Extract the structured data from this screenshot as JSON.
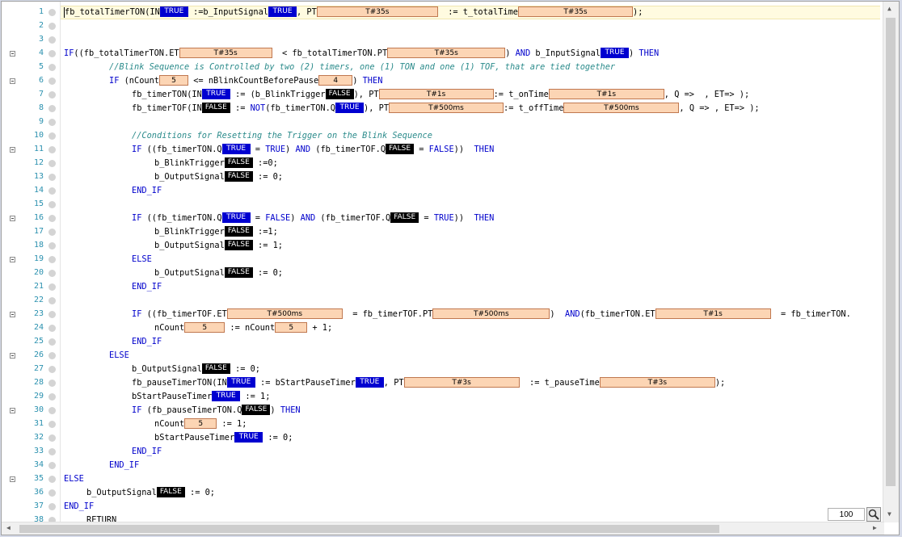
{
  "zoom": "100",
  "colors": {
    "true_bg": "#0000d0",
    "false_bg": "#000000",
    "value_bg": "#fcd5b4",
    "keyword": "#0000cc",
    "comment": "#2b8b8b",
    "line_number": "#2b91af"
  },
  "icons": {
    "fold": "collapse-minus-icon",
    "breakpoint": "breakpoint-dot-icon",
    "zoom": "magnifier-zoom-icon"
  },
  "lines": [
    {
      "n": "1",
      "fold": false,
      "ind": 0,
      "tok": [
        [
          "t",
          "fb_totalTimerTON(IN"
        ],
        [
          "mon",
          "true",
          "TRUE"
        ],
        [
          "t",
          " :=b_InputSignal"
        ],
        [
          "mon",
          "true",
          "TRUE"
        ],
        [
          "t",
          ", PT"
        ],
        [
          "val",
          "T#35s",
          150
        ],
        [
          "t",
          "  := t_totalTime"
        ],
        [
          "val",
          "T#35s",
          142
        ],
        [
          "t",
          ");"
        ]
      ]
    },
    {
      "n": "2",
      "fold": false,
      "ind": 0,
      "tok": []
    },
    {
      "n": "3",
      "fold": false,
      "ind": 0,
      "tok": []
    },
    {
      "n": "4",
      "fold": true,
      "ind": 0,
      "tok": [
        [
          "kw",
          "IF"
        ],
        [
          "t",
          "((fb_totalTimerTON.ET"
        ],
        [
          "val",
          "T#35s",
          115
        ],
        [
          "t",
          "  < fb_totalTimerTON.PT"
        ],
        [
          "val",
          "T#35s",
          146
        ],
        [
          "t",
          ") "
        ],
        [
          "kw",
          "AND"
        ],
        [
          "t",
          " b_InputSignal"
        ],
        [
          "mon",
          "true",
          "TRUE"
        ],
        [
          "t",
          ") "
        ],
        [
          "kw",
          "THEN"
        ]
      ]
    },
    {
      "n": "5",
      "fold": false,
      "ind": 8,
      "tok": [
        [
          "cm",
          "//Blink Sequence is Controlled by two (2) timers, one (1) TON and one (1) TOF, that are tied together"
        ]
      ]
    },
    {
      "n": "6",
      "fold": true,
      "ind": 8,
      "tok": [
        [
          "kw",
          "IF"
        ],
        [
          "t",
          " (nCount"
        ],
        [
          "val",
          "5",
          36
        ],
        [
          "t",
          " <= nBlinkCountBeforePause"
        ],
        [
          "val",
          "4",
          42
        ],
        [
          "t",
          ") "
        ],
        [
          "kw",
          "THEN"
        ]
      ]
    },
    {
      "n": "7",
      "fold": false,
      "ind": 12,
      "tok": [
        [
          "t",
          "fb_timerTON(IN"
        ],
        [
          "mon",
          "true",
          "TRUE"
        ],
        [
          "t",
          " := (b_BlinkTrigger"
        ],
        [
          "mon",
          "false",
          "FALSE"
        ],
        [
          "t",
          "), PT"
        ],
        [
          "val",
          "T#1s",
          142
        ],
        [
          "t",
          ":= t_onTime"
        ],
        [
          "val",
          "T#1s",
          143
        ],
        [
          "t",
          ", Q =>  , ET=> );"
        ]
      ]
    },
    {
      "n": "8",
      "fold": false,
      "ind": 12,
      "tok": [
        [
          "t",
          "fb_timerTOF(IN"
        ],
        [
          "mon",
          "false",
          "FALSE"
        ],
        [
          "t",
          " := "
        ],
        [
          "kw",
          "NOT"
        ],
        [
          "t",
          "(fb_timerTON.Q"
        ],
        [
          "mon",
          "true",
          "TRUE"
        ],
        [
          "t",
          "), PT"
        ],
        [
          "val",
          "T#500ms",
          142
        ],
        [
          "t",
          ":= t_offTime"
        ],
        [
          "val",
          "T#500ms",
          143
        ],
        [
          "t",
          ", Q => , ET=> );"
        ]
      ]
    },
    {
      "n": "9",
      "fold": false,
      "ind": 0,
      "tok": []
    },
    {
      "n": "10",
      "fold": false,
      "ind": 12,
      "tok": [
        [
          "cm",
          "//Conditions for Resetting the Trigger on the Blink Sequence"
        ]
      ]
    },
    {
      "n": "11",
      "fold": true,
      "ind": 12,
      "tok": [
        [
          "kw",
          "IF"
        ],
        [
          "t",
          " ((fb_timerTON.Q"
        ],
        [
          "mon",
          "true",
          "TRUE"
        ],
        [
          "t",
          " = "
        ],
        [
          "lit",
          "TRUE"
        ],
        [
          "t",
          ") "
        ],
        [
          "kw",
          "AND"
        ],
        [
          "t",
          " (fb_timerTOF.Q"
        ],
        [
          "mon",
          "false",
          "FALSE"
        ],
        [
          "t",
          " = "
        ],
        [
          "lit",
          "FALSE"
        ],
        [
          "t",
          "))  "
        ],
        [
          "kw",
          "THEN"
        ]
      ]
    },
    {
      "n": "12",
      "fold": false,
      "ind": 16,
      "tok": [
        [
          "t",
          "b_BlinkTrigger"
        ],
        [
          "mon",
          "false",
          "FALSE"
        ],
        [
          "t",
          " :=0;"
        ]
      ]
    },
    {
      "n": "13",
      "fold": false,
      "ind": 16,
      "tok": [
        [
          "t",
          "b_OutputSignal"
        ],
        [
          "mon",
          "false",
          "FALSE"
        ],
        [
          "t",
          " := 0;"
        ]
      ]
    },
    {
      "n": "14",
      "fold": false,
      "ind": 12,
      "tok": [
        [
          "kw",
          "END_IF"
        ]
      ]
    },
    {
      "n": "15",
      "fold": false,
      "ind": 0,
      "tok": []
    },
    {
      "n": "16",
      "fold": true,
      "ind": 12,
      "tok": [
        [
          "kw",
          "IF"
        ],
        [
          "t",
          " ((fb_timerTON.Q"
        ],
        [
          "mon",
          "true",
          "TRUE"
        ],
        [
          "t",
          " = "
        ],
        [
          "lit",
          "FALSE"
        ],
        [
          "t",
          ") "
        ],
        [
          "kw",
          "AND"
        ],
        [
          "t",
          " (fb_timerTOF.Q"
        ],
        [
          "mon",
          "false",
          "FALSE"
        ],
        [
          "t",
          " = "
        ],
        [
          "lit",
          "TRUE"
        ],
        [
          "t",
          "))  "
        ],
        [
          "kw",
          "THEN"
        ]
      ]
    },
    {
      "n": "17",
      "fold": false,
      "ind": 16,
      "tok": [
        [
          "t",
          "b_BlinkTrigger"
        ],
        [
          "mon",
          "false",
          "FALSE"
        ],
        [
          "t",
          " :=1;"
        ]
      ]
    },
    {
      "n": "18",
      "fold": false,
      "ind": 16,
      "tok": [
        [
          "t",
          "b_OutputSignal"
        ],
        [
          "mon",
          "false",
          "FALSE"
        ],
        [
          "t",
          " := 1;"
        ]
      ]
    },
    {
      "n": "19",
      "fold": true,
      "ind": 12,
      "tok": [
        [
          "kw",
          "ELSE"
        ]
      ]
    },
    {
      "n": "20",
      "fold": false,
      "ind": 16,
      "tok": [
        [
          "t",
          "b_OutputSignal"
        ],
        [
          "mon",
          "false",
          "FALSE"
        ],
        [
          "t",
          " := 0;"
        ]
      ]
    },
    {
      "n": "21",
      "fold": false,
      "ind": 12,
      "tok": [
        [
          "kw",
          "END_IF"
        ]
      ]
    },
    {
      "n": "22",
      "fold": false,
      "ind": 0,
      "tok": []
    },
    {
      "n": "23",
      "fold": true,
      "ind": 12,
      "tok": [
        [
          "kw",
          "IF"
        ],
        [
          "t",
          " ((fb_timerTOF.ET"
        ],
        [
          "val",
          "T#500ms",
          143
        ],
        [
          "t",
          "  = fb_timerTOF.PT"
        ],
        [
          "val",
          "T#500ms",
          145
        ],
        [
          "t",
          ")  "
        ],
        [
          "kw",
          "AND"
        ],
        [
          "t",
          "(fb_timerTON.ET"
        ],
        [
          "val",
          "T#1s",
          143
        ],
        [
          "t",
          "  = fb_timerTON."
        ]
      ]
    },
    {
      "n": "24",
      "fold": false,
      "ind": 16,
      "tok": [
        [
          "t",
          "nCount"
        ],
        [
          "val",
          "5",
          50
        ],
        [
          "t",
          " := nCount"
        ],
        [
          "val",
          "5",
          40
        ],
        [
          "t",
          " + 1;"
        ]
      ]
    },
    {
      "n": "25",
      "fold": false,
      "ind": 12,
      "tok": [
        [
          "kw",
          "END_IF"
        ]
      ]
    },
    {
      "n": "26",
      "fold": true,
      "ind": 8,
      "tok": [
        [
          "kw",
          "ELSE"
        ]
      ]
    },
    {
      "n": "27",
      "fold": false,
      "ind": 12,
      "tok": [
        [
          "t",
          "b_OutputSignal"
        ],
        [
          "mon",
          "false",
          "FALSE"
        ],
        [
          "t",
          " := 0;"
        ]
      ]
    },
    {
      "n": "28",
      "fold": false,
      "ind": 12,
      "tok": [
        [
          "t",
          "fb_pauseTimerTON(IN"
        ],
        [
          "mon",
          "true",
          "TRUE"
        ],
        [
          "t",
          " := bStartPauseTimer"
        ],
        [
          "mon",
          "true",
          "TRUE"
        ],
        [
          "t",
          ", PT"
        ],
        [
          "val",
          "T#3s",
          143
        ],
        [
          "t",
          "  := t_pauseTime"
        ],
        [
          "val",
          "T#3s",
          143
        ],
        [
          "t",
          ");"
        ]
      ]
    },
    {
      "n": "29",
      "fold": false,
      "ind": 12,
      "tok": [
        [
          "t",
          "bStartPauseTimer"
        ],
        [
          "mon",
          "true",
          "TRUE"
        ],
        [
          "t",
          " := 1;"
        ]
      ]
    },
    {
      "n": "30",
      "fold": true,
      "ind": 12,
      "tok": [
        [
          "kw",
          "IF"
        ],
        [
          "t",
          " (fb_pauseTimerTON.Q"
        ],
        [
          "mon",
          "false",
          "FALSE"
        ],
        [
          "t",
          ") "
        ],
        [
          "kw",
          "THEN"
        ]
      ]
    },
    {
      "n": "31",
      "fold": false,
      "ind": 16,
      "tok": [
        [
          "t",
          "nCount"
        ],
        [
          "val",
          "5",
          40
        ],
        [
          "t",
          " := 1;"
        ]
      ]
    },
    {
      "n": "32",
      "fold": false,
      "ind": 16,
      "tok": [
        [
          "t",
          "bStartPauseTimer"
        ],
        [
          "mon",
          "true",
          "TRUE"
        ],
        [
          "t",
          " := 0;"
        ]
      ]
    },
    {
      "n": "33",
      "fold": false,
      "ind": 12,
      "tok": [
        [
          "kw",
          "END_IF"
        ]
      ]
    },
    {
      "n": "34",
      "fold": false,
      "ind": 8,
      "tok": [
        [
          "kw",
          "END_IF"
        ]
      ]
    },
    {
      "n": "35",
      "fold": true,
      "ind": 0,
      "tok": [
        [
          "kw",
          "ELSE"
        ]
      ]
    },
    {
      "n": "36",
      "fold": false,
      "ind": 4,
      "tok": [
        [
          "t",
          "b_OutputSignal"
        ],
        [
          "mon",
          "false",
          "FALSE"
        ],
        [
          "t",
          " := 0;"
        ]
      ]
    },
    {
      "n": "37",
      "fold": false,
      "ind": 0,
      "tok": [
        [
          "kw",
          "END_IF"
        ]
      ]
    },
    {
      "n": "38",
      "fold": false,
      "ind": 4,
      "tok": [
        [
          "t",
          "RETURN"
        ]
      ]
    }
  ]
}
